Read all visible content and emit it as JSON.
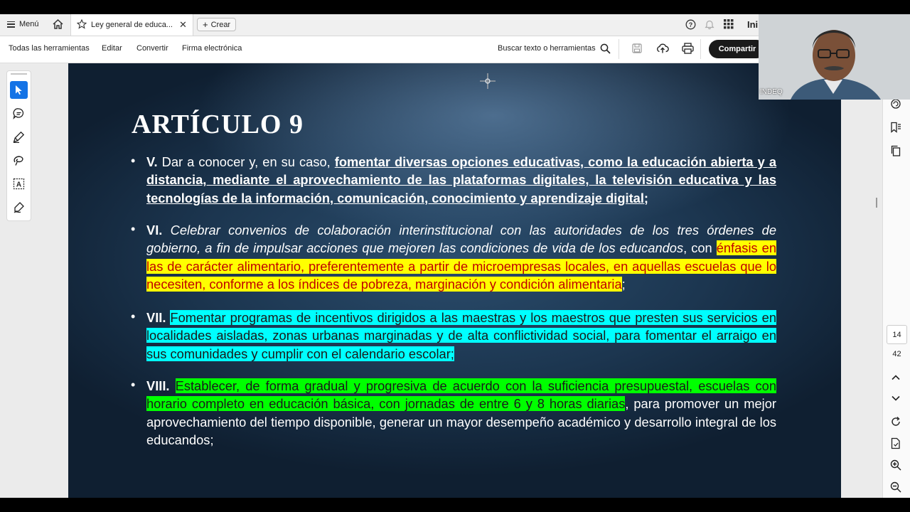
{
  "tabbar": {
    "menu_label": "Menú",
    "tab_title": "Ley general de educa...",
    "create_label": "Crear",
    "right_text": "Ini"
  },
  "toolbar": {
    "all_tools": "Todas las herramientas",
    "edit": "Editar",
    "convert": "Convertir",
    "esign": "Firma electrónica",
    "search": "Buscar texto o herramientas",
    "share": "Compartir"
  },
  "slide": {
    "title": "ARTÍCULO 9",
    "p5": {
      "num": "V.",
      "text_a": " Dar a conocer y, en su caso, ",
      "text_u": "fomentar diversas opciones educativas, como la educación abierta y a distancia, mediante el aprovechamiento de las plataformas digitales, la televisión educativa y las tecnologías de la información, comunicación, conocimiento y aprendizaje digital;"
    },
    "p6": {
      "num": "VI.",
      "text_it": " Celebrar convenios de colaboración interinstitucional con las autoridades de los tres órdenes de gobierno, a fin de impulsar acciones que mejoren las condiciones de vida de los educandos",
      "text_b": ", con ",
      "text_hl": "énfasis en las de carácter alimentario, preferentemente a partir de microempresas locales, en aquellas escuelas que lo necesiten, conforme a los índices de pobreza, marginación y condición alimentaria",
      "text_end": ";"
    },
    "p7": {
      "num": "VII.",
      "text_hl": "Fomentar programas de incentivos dirigidos a las maestras y los maestros que presten sus servicios en localidades aisladas, zonas urbanas marginadas y de alta conflictividad social, para fomentar el arraigo en sus comunidades y cumplir con el calendario escolar;"
    },
    "p8": {
      "num": "VIII.",
      "text_hl": "Establecer, de forma gradual y progresiva de acuerdo con la suficiencia presupuestal, escuelas con horario completo en educación básica, con jornadas de entre 6 y 8 horas diarias",
      "text_rest": ", para promover un mejor aprovechamiento del tiempo disponible, generar un mayor desempeño académico y desarrollo integral de los educandos;"
    }
  },
  "pager": {
    "current": "14",
    "total": "42"
  },
  "webcam": {
    "name": "INDEQ"
  },
  "colors": {
    "yellow": "#ffff00",
    "cyan": "#00ffff",
    "green": "#00ff00",
    "share_bg": "#1a1a1a",
    "active_tool": "#1473e6"
  }
}
